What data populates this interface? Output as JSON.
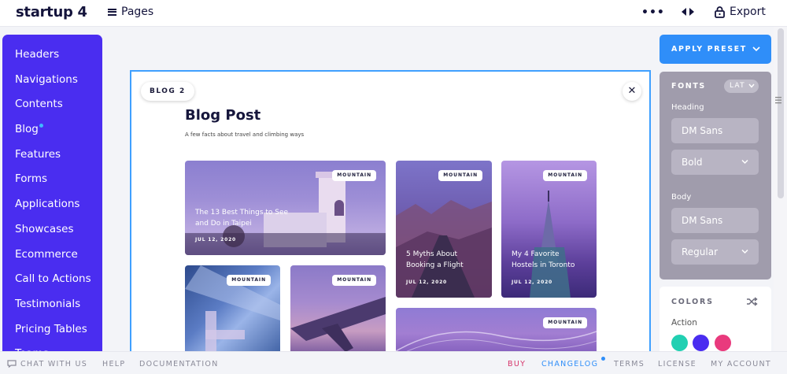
{
  "app": {
    "logo": "startup 4",
    "pages_label": "Pages",
    "export_label": "Export"
  },
  "sidebar": {
    "items": [
      {
        "label": "Headers"
      },
      {
        "label": "Navigations"
      },
      {
        "label": "Contents"
      },
      {
        "label": "Blog",
        "dot": true
      },
      {
        "label": "Features"
      },
      {
        "label": "Forms"
      },
      {
        "label": "Applications"
      },
      {
        "label": "Showcases"
      },
      {
        "label": "Ecommerce"
      },
      {
        "label": "Call to Actions"
      },
      {
        "label": "Testimonials"
      },
      {
        "label": "Pricing Tables"
      },
      {
        "label": "Teams"
      }
    ]
  },
  "canvas": {
    "block_tag": "BLOG 2",
    "close_glyph": "✕",
    "title": "Blog Post",
    "subtitle": "A few facts about travel and climbing ways",
    "cards": [
      {
        "badge": "MOUNTAIN",
        "title_lines": [
          "The 13 Best Things to See",
          "and Do in Taipei"
        ],
        "date": "JUL 12, 2020"
      },
      {
        "badge": "MOUNTAIN",
        "title_lines": [
          "5 Myths About",
          "Booking a Flight"
        ],
        "date": "JUL 12, 2020"
      },
      {
        "badge": "MOUNTAIN",
        "title_lines": [
          "My 4 Favorite",
          "Hostels in Toronto"
        ],
        "date": "JUL 12, 2020"
      },
      {
        "badge": "MOUNTAIN"
      },
      {
        "badge": "MOUNTAIN"
      },
      {
        "badge": "MOUNTAIN"
      }
    ]
  },
  "panel": {
    "preset_label": "APPLY PRESET",
    "fonts_label": "FONTS",
    "lang": "LAT",
    "heading_label": "Heading",
    "heading_font": "DM Sans",
    "heading_weight": "Bold",
    "body_label": "Body",
    "body_font": "DM Sans",
    "body_weight": "Regular",
    "colors_label": "COLORS",
    "action_label": "Action",
    "swatches": [
      "#21d0b2",
      "#4a2df0",
      "#e93a7d"
    ]
  },
  "footer": {
    "chat": "CHAT WITH US",
    "help": "HELP",
    "docs": "DOCUMENTATION",
    "buy": "BUY",
    "changelog": "CHANGELOG",
    "terms": "TERMS",
    "license": "LICENSE",
    "account": "MY ACCOUNT"
  },
  "colors": {
    "sidebar": "#4a2df0",
    "accent": "#2f8ef9",
    "buy": "#d6346a"
  }
}
